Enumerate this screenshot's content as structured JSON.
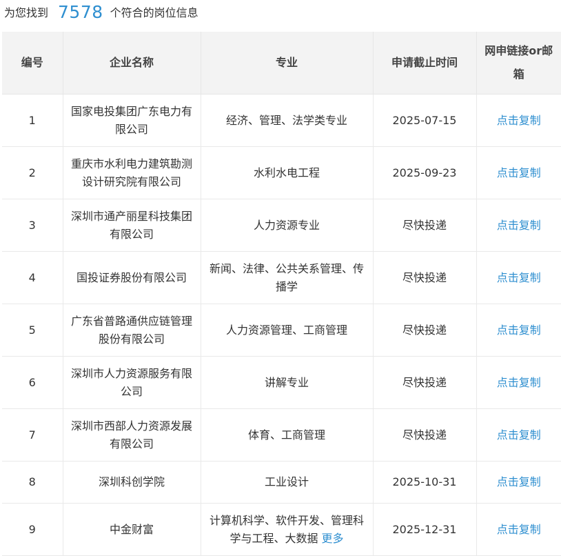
{
  "summary": {
    "prefix": "为您找到",
    "count": "7578",
    "suffix": "个符合的岗位信息"
  },
  "table": {
    "headers": {
      "no": "编号",
      "company": "企业名称",
      "major": "专业",
      "deadline": "申请截止时间",
      "link": "网申链接or邮箱"
    },
    "rows": [
      {
        "no": "1",
        "company": "国家电投集团广东电力有限公司",
        "major": "经济、管理、法学类专业",
        "deadline": "2025-07-15",
        "link": "点击复制"
      },
      {
        "no": "2",
        "company": "重庆市水利电力建筑勘测设计研究院有限公司",
        "major": "水利水电工程",
        "deadline": "2025-09-23",
        "link": "点击复制"
      },
      {
        "no": "3",
        "company": "深圳市通产丽星科技集团有限公司",
        "major": "人力资源专业",
        "deadline": "尽快投递",
        "link": "点击复制"
      },
      {
        "no": "4",
        "company": "国投证券股份有限公司",
        "major": "新闻、法律、公共关系管理、传播学",
        "deadline": "尽快投递",
        "link": "点击复制"
      },
      {
        "no": "5",
        "company": "广东省普路通供应链管理股份有限公司",
        "major": "人力资源管理、工商管理",
        "deadline": "尽快投递",
        "link": "点击复制"
      },
      {
        "no": "6",
        "company": "深圳市人力资源服务有限公司",
        "major": "讲解专业",
        "deadline": "尽快投递",
        "link": "点击复制"
      },
      {
        "no": "7",
        "company": "深圳市西部人力资源发展有限公司",
        "major": "体育、工商管理",
        "deadline": "尽快投递",
        "link": "点击复制"
      },
      {
        "no": "8",
        "company": "深圳科创学院",
        "major": "工业设计",
        "deadline": "2025-10-31",
        "link": "点击复制"
      },
      {
        "no": "9",
        "company": "中金财富",
        "major": "计算机科学、软件开发、管理科学与工程、大数据",
        "deadline": "2025-12-31",
        "link": "点击复制",
        "more": "更多"
      }
    ]
  }
}
